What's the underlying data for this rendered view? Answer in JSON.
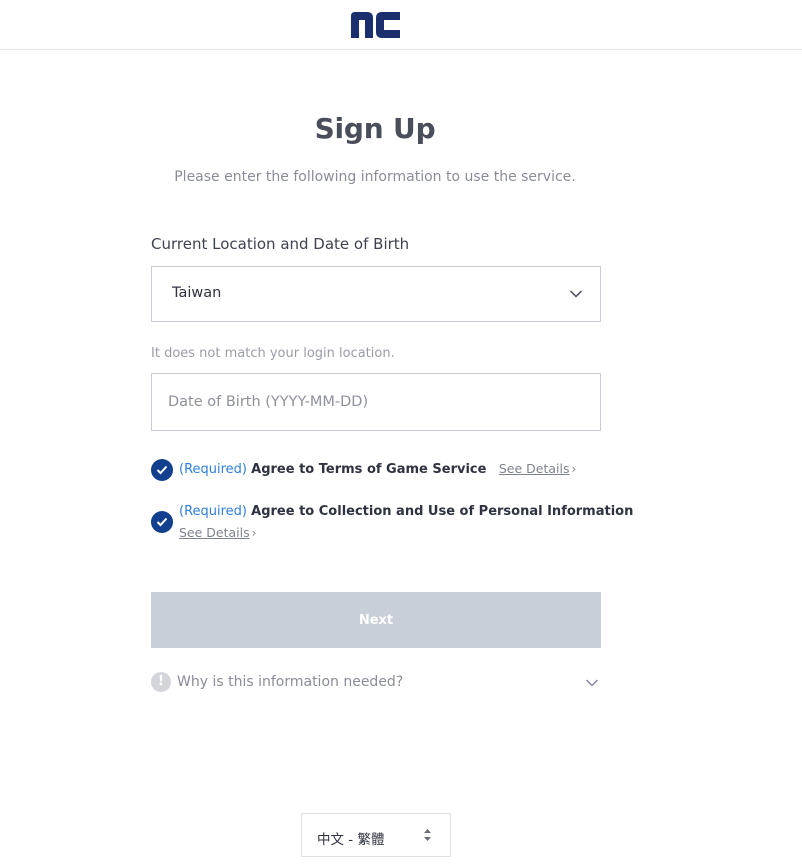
{
  "header": {
    "logo_text": "nc"
  },
  "page": {
    "title": "Sign Up",
    "subtitle": "Please enter the following information to use the service."
  },
  "form": {
    "section_label": "Current Location and Date of Birth",
    "location": {
      "selected": "Taiwan"
    },
    "location_hint": "It does not match your login location.",
    "dob": {
      "value": "",
      "placeholder": "Date of Birth (YYYY-MM-DD)"
    },
    "agreements": [
      {
        "required": "(Required)",
        "label": "Agree to Terms of Game Service",
        "details": "See Details",
        "checked": true
      },
      {
        "required": "(Required)",
        "label": "Agree to Collection and Use of Personal Information",
        "details": "See Details",
        "checked": true
      }
    ],
    "next_label": "Next",
    "why_label": "Why is this information needed?"
  },
  "footer": {
    "language": "中文 - 繁體"
  },
  "colors": {
    "brand": "#1b2f6e",
    "checkbox": "#12408e",
    "required_text": "#2f7fdb",
    "button_disabled": "#c8cfd8"
  },
  "icons": [
    "nc-logo",
    "chevron-down-icon",
    "check-icon",
    "info-icon",
    "sort-arrows-icon"
  ]
}
